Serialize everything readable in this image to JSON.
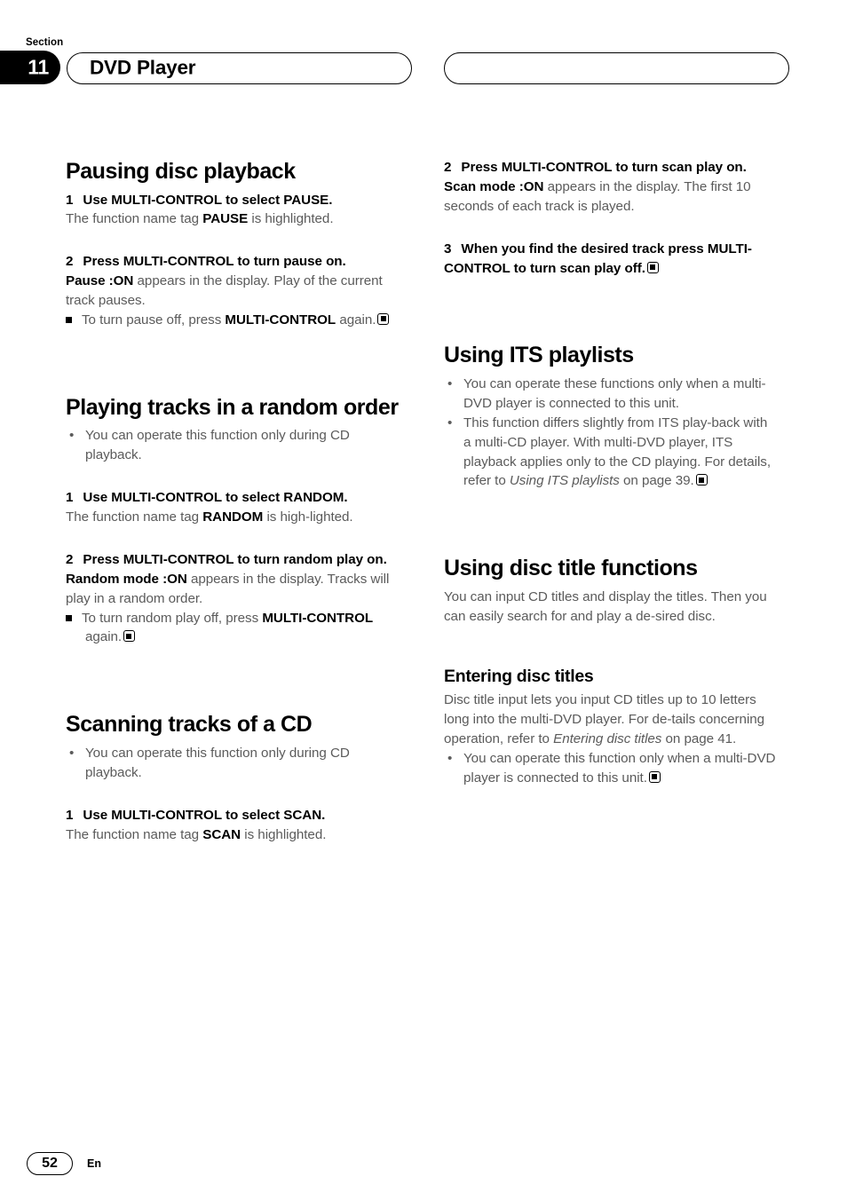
{
  "header": {
    "section_label": "Section",
    "section_number": "11",
    "chapter_title": "DVD Player",
    "right_pill_text": ""
  },
  "footer": {
    "page_number": "52",
    "language": "En"
  },
  "left_column": {
    "topic1": {
      "heading": "Pausing disc playback",
      "step1": {
        "num": "1",
        "text": "Use MULTI-CONTROL to select PAUSE.",
        "result_pre": "The function name tag ",
        "result_bold": "PAUSE",
        "result_post": " is highlighted."
      },
      "step2": {
        "num": "2",
        "text": "Press MULTI-CONTROL to turn pause on.",
        "result_bold": "Pause :ON",
        "result_post": " appears in the display. Play of the current track pauses.",
        "note_pre": "To turn pause off, press ",
        "note_bold": "MULTI-CONTROL",
        "note_post": " again."
      }
    },
    "topic2": {
      "heading": "Playing tracks in a random order",
      "bullet1": "You can operate this function only during CD playback.",
      "step1": {
        "num": "1",
        "text": "Use MULTI-CONTROL to select RANDOM.",
        "result_pre": "The function name tag ",
        "result_bold": "RANDOM",
        "result_post": " is high-lighted."
      },
      "step2": {
        "num": "2",
        "text": "Press MULTI-CONTROL to turn random play on.",
        "result_bold": "Random mode :ON",
        "result_post": " appears in the display. Tracks will play in a random order.",
        "note_pre": "To turn random play off, press ",
        "note_bold": "MULTI-CONTROL",
        "note_post": " again."
      }
    },
    "topic3": {
      "heading": "Scanning tracks of a CD",
      "bullet1": "You can operate this function only during CD playback.",
      "step1": {
        "num": "1",
        "text": "Use MULTI-CONTROL to select SCAN.",
        "result_pre": "The function name tag ",
        "result_bold": "SCAN",
        "result_post": " is highlighted."
      }
    }
  },
  "right_column": {
    "topic3_cont": {
      "step2": {
        "num": "2",
        "text": "Press MULTI-CONTROL to turn scan play on.",
        "result_bold": "Scan mode :ON",
        "result_post": " appears in the display. The first 10 seconds of each track is played."
      },
      "step3": {
        "num": "3",
        "text": "When you find the desired track press MULTI-CONTROL to turn scan play off."
      }
    },
    "topic4": {
      "heading": "Using ITS playlists",
      "bullet1": "You can operate these functions only when a multi-DVD player is connected to this unit.",
      "bullet2_pre": "This function differs slightly from ITS play-back with a multi-CD player. With multi-DVD player, ITS playback applies only to the CD playing. For details, refer to ",
      "bullet2_italic": "Using ITS playlists",
      "bullet2_post": " on page 39."
    },
    "topic5": {
      "heading": "Using disc title functions",
      "intro": "You can input CD titles and display the titles. Then you can easily search for and play a de-sired disc.",
      "subheading": "Entering disc titles",
      "sub_intro_pre": "Disc title input lets you input CD titles up to 10 letters long into the multi-DVD player. For de-tails concerning operation, refer to ",
      "sub_intro_italic": "Entering disc titles",
      "sub_intro_post": " on page 41.",
      "bullet1": "You can operate this function only when a multi-DVD player is connected to this unit."
    }
  }
}
